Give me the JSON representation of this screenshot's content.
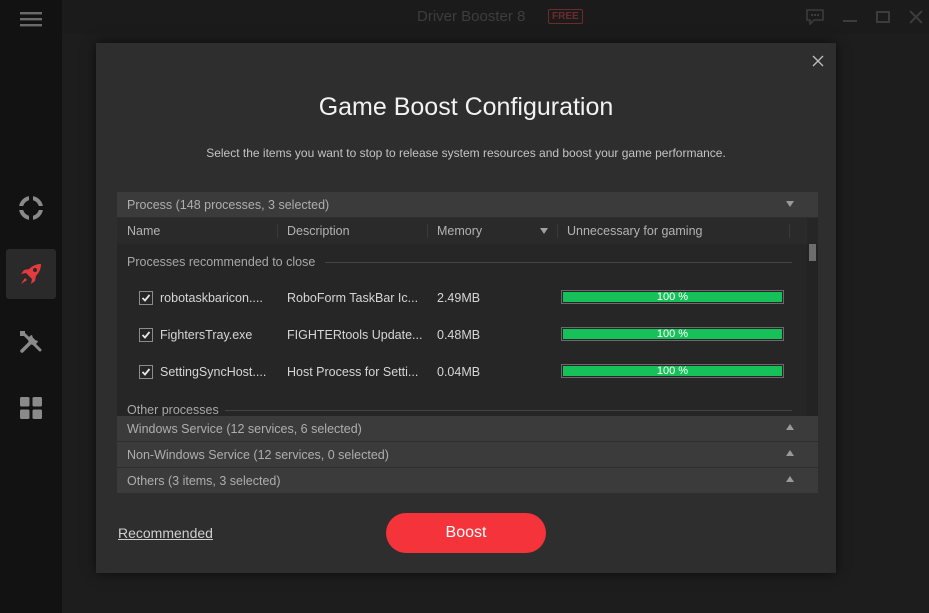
{
  "app": {
    "title": "Driver Booster 8",
    "badge": "FREE"
  },
  "dialog": {
    "title": "Game Boost Configuration",
    "subtitle": "Select the items you want to stop to release system resources and boost your game performance.",
    "process_section": "Process (148 processes, 3 selected)",
    "columns": {
      "name": "Name",
      "description": "Description",
      "memory": "Memory",
      "unnecessary": "Unnecessary for gaming"
    },
    "group_recommended": "Processes recommended to close",
    "group_other": "Other processes",
    "rows": [
      {
        "name": "robotaskbaricon....",
        "description": "RoboForm TaskBar Ic...",
        "memory": "2.49MB",
        "unnecessary_pct": 100,
        "unnecessary_label": "100 %",
        "checked": true
      },
      {
        "name": "FightersTray.exe",
        "description": "FIGHTERtools Update...",
        "memory": "0.48MB",
        "unnecessary_pct": 100,
        "unnecessary_label": "100 %",
        "checked": true
      },
      {
        "name": "SettingSyncHost....",
        "description": "Host Process for Setti...",
        "memory": "0.04MB",
        "unnecessary_pct": 100,
        "unnecessary_label": "100 %",
        "checked": true
      }
    ],
    "sections": {
      "windows_service": "Windows Service (12 services, 6 selected)",
      "non_windows_service": "Non-Windows Service (12 services, 0 selected)",
      "others": "Others (3 items, 3 selected)"
    },
    "recommended_link": "Recommended",
    "boost_button": "Boost"
  },
  "colors": {
    "accent": "#f5333b",
    "progress": "#17c15a",
    "dialog_bg": "#2e2e2e"
  },
  "icons": {
    "menu": "hamburger-menu-icon",
    "nav": [
      "lifebuoy-icon",
      "rocket-icon",
      "tools-icon",
      "grid-apps-icon"
    ],
    "window": [
      "feedback-icon",
      "minimize-icon",
      "maximize-icon",
      "close-icon"
    ]
  }
}
